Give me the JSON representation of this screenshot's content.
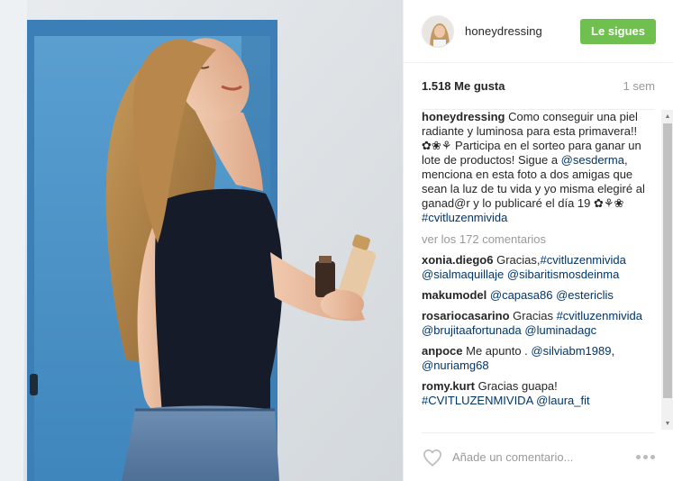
{
  "header": {
    "username": "honeydressing",
    "follow_label": "Le sigues",
    "follow_color": "#70c050"
  },
  "stats": {
    "likes": "1.518 Me gusta",
    "time": "1 sem"
  },
  "caption": {
    "user": "honeydressing",
    "text_1": " Como conseguir una piel radiante y luminosa para esta primavera!!✿❀⚘ Participa en el sorteo para ganar un lote de productos! Sigue a ",
    "mention_1": "@sesderma",
    "text_2": ", menciona en esta foto a dos amigas que sean la luz de tu vida y yo misma elegiré al ganad@r y lo publicaré el día 19 ✿⚘❀ ",
    "hashtag": "#cvitluzenmivida"
  },
  "view_all_comments": "ver los 172 comentarios",
  "comments": [
    {
      "user": "xonia.diego6",
      "parts": [
        " Gracias,",
        "#cvitluzenmivida",
        " ",
        "@sialmaquillaje",
        " ",
        "@sibaritismosdeinma"
      ]
    },
    {
      "user": "makumodel",
      "parts": [
        " ",
        "@capasa86",
        " ",
        "@estericlis"
      ]
    },
    {
      "user": "rosariocasarino",
      "parts": [
        " Gracias ",
        "#cvitluzenmivida",
        " ",
        "@brujitaafortunada",
        " ",
        "@luminadagc"
      ]
    },
    {
      "user": "anpoce",
      "parts": [
        " Me apunto . ",
        "@silviabm1989",
        ", ",
        "@nuriamg68"
      ]
    },
    {
      "user": "romy.kurt",
      "parts": [
        " Gracias guapa! ",
        "#CVITLUZENMIVIDA",
        " ",
        "@laura_fit"
      ]
    }
  ],
  "comment_input": {
    "placeholder": "Añade un comentario..."
  },
  "icons": {
    "like": "heart-outline-icon",
    "more": "more-options-icon",
    "scroll_up": "scroll-up-arrow-icon",
    "scroll_down": "scroll-down-arrow-icon"
  },
  "colors": {
    "link": "#003569",
    "muted": "#999999",
    "text": "#262626",
    "door_blue": "#4f95c9"
  }
}
